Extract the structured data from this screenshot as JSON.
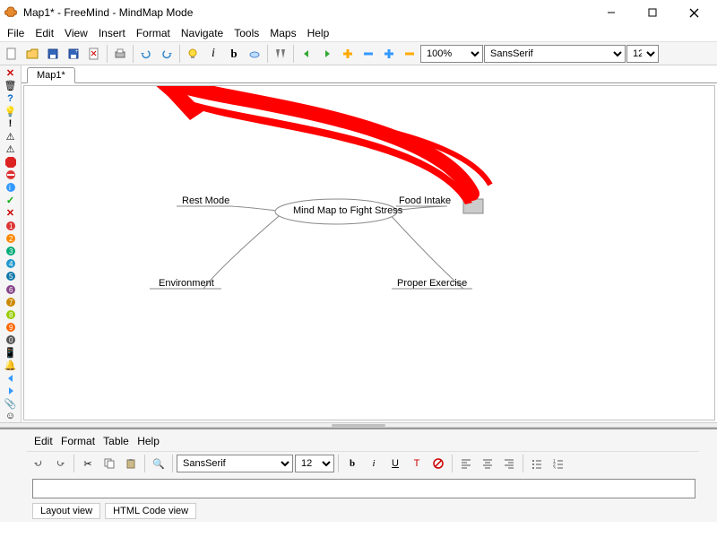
{
  "window": {
    "title": "Map1* - FreeMind - MindMap Mode"
  },
  "menus": {
    "file": "File",
    "edit": "Edit",
    "view": "View",
    "insert": "Insert",
    "format": "Format",
    "navigate": "Navigate",
    "tools": "Tools",
    "maps": "Maps",
    "help": "Help"
  },
  "toolbar": {
    "zoom": "100%",
    "font": "SansSerif",
    "size": "12"
  },
  "tab": {
    "label": "Map1*"
  },
  "mindmap": {
    "center": "Mind Map to Fight Stress",
    "nodes": {
      "rest": "Rest Mode",
      "food": "Food Intake",
      "env": "Environment",
      "ex": "Proper Exercise"
    }
  },
  "editor": {
    "menus": {
      "edit": "Edit",
      "format": "Format",
      "table": "Table",
      "help": "Help"
    },
    "font": "SansSerif",
    "size": "12",
    "views": {
      "layout": "Layout view",
      "html": "HTML Code view"
    }
  }
}
